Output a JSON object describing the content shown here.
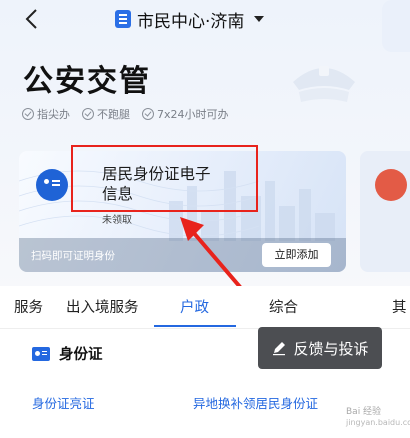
{
  "header": {
    "city": "市民中心·济南"
  },
  "page": {
    "title": "公安交管",
    "features": [
      "指尖办",
      "不跑腿",
      "7x24小时可办"
    ]
  },
  "card": {
    "title": "居民身份证电子信息",
    "status": "未领取",
    "hint": "扫码即可证明身份",
    "add_button": "立即添加"
  },
  "tabs": [
    {
      "label": "服务"
    },
    {
      "label": "出入境服务"
    },
    {
      "label": "户政",
      "active": true
    },
    {
      "label": "综合"
    },
    {
      "label": "其"
    }
  ],
  "section": {
    "title": "身份证",
    "services": [
      "身份证亮证",
      "异地换补领居民身份证"
    ]
  },
  "feedback": {
    "label": "反馈与投诉"
  },
  "watermark": {
    "line1": "Bai 经验",
    "line2": "jingyan.baidu.com"
  },
  "colors": {
    "accent": "#2468e0",
    "annotation": "#e8231c",
    "feedback_bg": "#4c4e52"
  }
}
